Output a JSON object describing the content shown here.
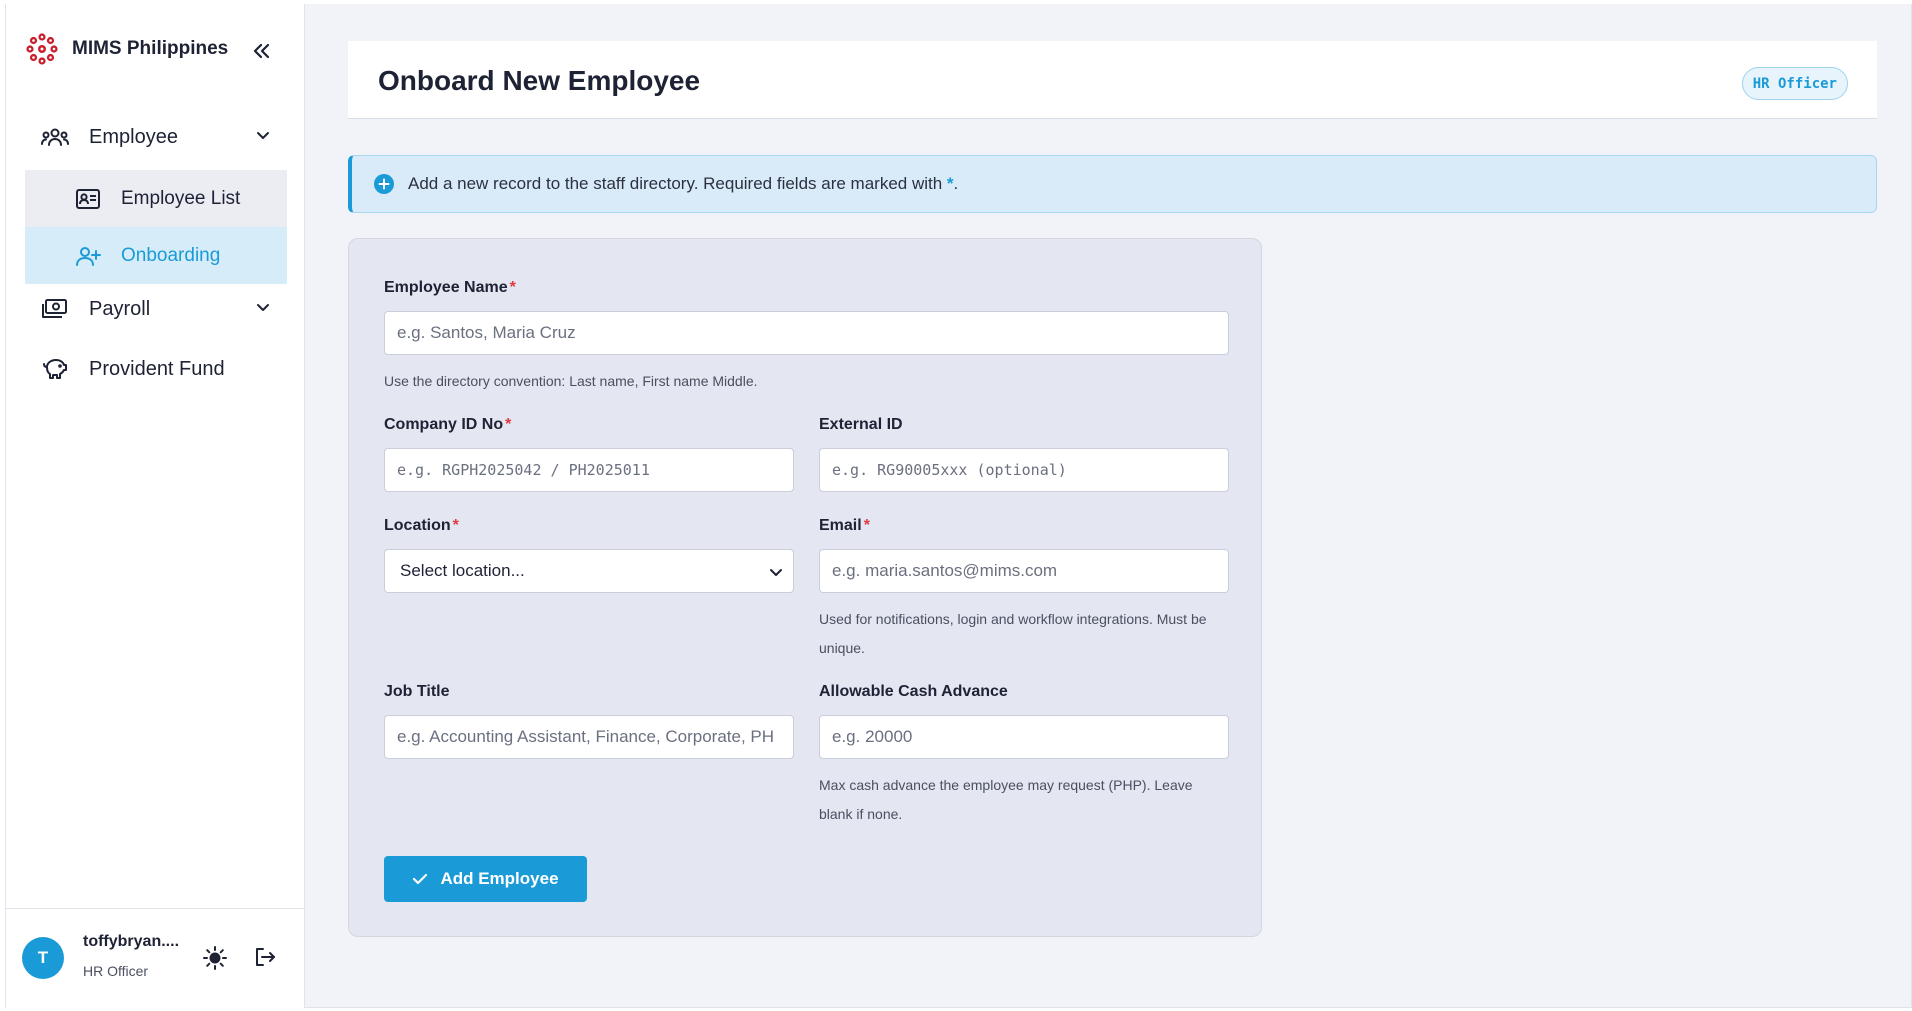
{
  "brand": {
    "name": "MIMS Philippines",
    "logo_icon": "flower-logo-icon",
    "accent": "#c8202f"
  },
  "sidebar": {
    "collapse_icon": "double-chevron-left-icon",
    "groups": [
      {
        "label": "Employee",
        "icon": "users-icon",
        "expanded": true,
        "items": [
          {
            "label": "Employee List",
            "icon": "id-card-icon",
            "active": false
          },
          {
            "label": "Onboarding",
            "icon": "user-plus-icon",
            "active": true
          }
        ]
      },
      {
        "label": "Payroll",
        "icon": "cash-icon",
        "expanded": false
      },
      {
        "label": "Provident Fund",
        "icon": "piggy-bank-icon"
      }
    ]
  },
  "user": {
    "initial": "T",
    "name": "toffybryan....",
    "role": "HR Officer",
    "theme_icon": "sun-icon",
    "logout_icon": "logout-icon"
  },
  "header": {
    "title": "Onboard New Employee",
    "role_badge": "HR Officer"
  },
  "banner": {
    "text": "Add a new record to the staff directory. Required fields are marked with ",
    "star": "*",
    "end": "."
  },
  "form": {
    "employee_name": {
      "label": "Employee Name",
      "required": "*",
      "placeholder": "e.g. Santos, Maria Cruz",
      "hint": "Use the directory convention: Last name, First name Middle."
    },
    "company_id": {
      "label": "Company ID No",
      "required": "*",
      "placeholder": "e.g. RGPH2025042 / PH2025011"
    },
    "external_id": {
      "label": "External ID",
      "placeholder": "e.g. RG90005xxx (optional)"
    },
    "location": {
      "label": "Location",
      "required": "*",
      "selected": "Select location..."
    },
    "email": {
      "label": "Email",
      "required": "*",
      "placeholder": "e.g. maria.santos@mims.com",
      "hint": "Used for notifications, login and workflow integrations. Must be unique."
    },
    "job_title": {
      "label": "Job Title",
      "placeholder": "e.g. Accounting Assistant, Finance, Corporate, PH"
    },
    "cash_advance": {
      "label": "Allowable Cash Advance",
      "placeholder": "e.g. 20000",
      "hint": "Max cash advance the employee may request (PHP). Leave blank if none."
    },
    "submit_label": "Add Employee"
  },
  "colors": {
    "primary": "#1a9bd8",
    "required": "#e0393e",
    "bg": "#f1f3f8"
  }
}
